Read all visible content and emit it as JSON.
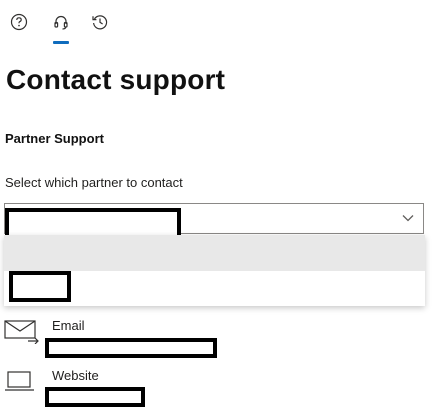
{
  "nav": {
    "items": [
      {
        "name": "help",
        "icon": "help-icon",
        "active": false
      },
      {
        "name": "support",
        "icon": "headset-icon",
        "active": true
      },
      {
        "name": "history",
        "icon": "history-icon",
        "active": false
      }
    ]
  },
  "page_title": "Contact support",
  "section_title": "Partner Support",
  "partner_select": {
    "label": "Select which partner to contact",
    "selected_value": "[redacted]",
    "icon": "chevron-down-icon",
    "options": [
      "[redacted]",
      "[redacted]"
    ]
  },
  "contacts": [
    {
      "type": "email",
      "icon": "mail-icon",
      "label": "Email",
      "value": "[redacted]"
    },
    {
      "type": "website",
      "icon": "laptop-icon",
      "label": "Website",
      "value": "[redacted]"
    }
  ],
  "colors": {
    "accent": "#0f6cbd",
    "hover": "#e8e8e8",
    "text": "#201f1e"
  }
}
